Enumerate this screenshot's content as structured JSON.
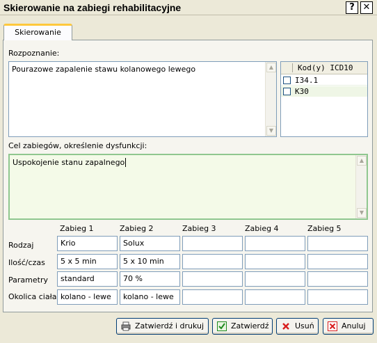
{
  "window": {
    "title": "Skierowanie na zabiegi rehabilitacyjne",
    "help_label": "?",
    "close_label": "✕"
  },
  "tabs": [
    {
      "label": "Skierowanie",
      "active": true
    }
  ],
  "diagnosis": {
    "label": "Rozpoznanie:",
    "value": "Pourazowe zapalenie stawu kolanowego lewego"
  },
  "icd": {
    "header": "Kod(y) ICD10",
    "rows": [
      {
        "code": "I34.1",
        "checked": false
      },
      {
        "code": "K30",
        "checked": false
      }
    ]
  },
  "goal": {
    "label": "Cel zabiegów, określenie dysfunkcji:",
    "value": "Uspokojenie stanu zapalnego"
  },
  "treatments": {
    "columns": [
      "Zabieg 1",
      "Zabieg 2",
      "Zabieg 3",
      "Zabieg 4",
      "Zabieg 5"
    ],
    "rows": [
      {
        "label": "Rodzaj",
        "values": [
          "Krio",
          "Solux",
          "",
          "",
          ""
        ]
      },
      {
        "label": "Ilość/czas",
        "values": [
          "5 x 5 min",
          "5 x 10 min",
          "",
          "",
          ""
        ]
      },
      {
        "label": "Parametry",
        "values": [
          "standard",
          "70 %",
          "",
          "",
          ""
        ]
      },
      {
        "label": "Okolica ciała",
        "values": [
          "kolano - lewe",
          "kolano - lewe",
          "",
          "",
          ""
        ]
      }
    ]
  },
  "buttons": {
    "confirm_print": "Zatwierdź i drukuj",
    "confirm": "Zatwierdź",
    "delete": "Usuń",
    "cancel": "Anuluj"
  },
  "colors": {
    "active_tab_accent": "#ffc83c",
    "focused_field_bg": "#f4fae8",
    "focused_field_border": "#8fc78f",
    "cancel_icon": "#d81e1e",
    "confirm_icon": "#1f8a1f"
  },
  "icons": {
    "print": "printer-icon",
    "confirm": "checkmark-icon",
    "delete": "x-icon",
    "cancel": "cancel-icon"
  }
}
